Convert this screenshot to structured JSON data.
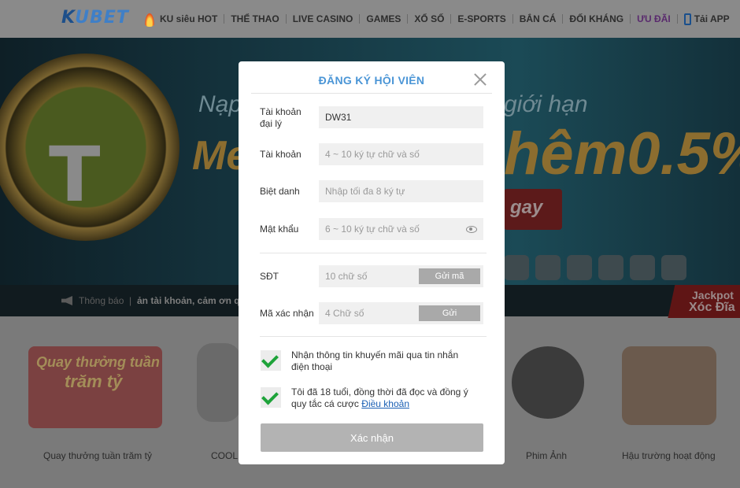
{
  "nav": {
    "logo": "KUBET",
    "items": [
      {
        "label": "KU siêu HOT",
        "icon": "fire-icon"
      },
      {
        "label": "THỂ THAO"
      },
      {
        "label": "LIVE CASINO"
      },
      {
        "label": "GAMES"
      },
      {
        "label": "XỔ SỐ"
      },
      {
        "label": "E-SPORTS"
      },
      {
        "label": "BẮN CÁ"
      },
      {
        "label": "ĐỐI KHÁNG"
      },
      {
        "label": "ƯU ĐÃI"
      },
      {
        "label": "Tải APP",
        "icon": "phone-icon"
      }
    ]
  },
  "banner": {
    "line1_left": "Nạp",
    "line1_right": "giới hạn",
    "big_left": "Me",
    "big_right": "hêm0.5%",
    "cta": "gay",
    "notice_label": "Thông báo",
    "notice_sep": "|",
    "notice_text": "ản tài khoản, cảm ơn qu",
    "jackpot_line1": "Jackpot",
    "jackpot_line2": "Xóc Đĩa"
  },
  "tiles": {
    "card_line1": "Quay thưởng tuần",
    "card_line2": "trăm tỷ",
    "labels": [
      "Quay thưởng tuần trăm tỷ",
      "COOL",
      "Phim Ảnh",
      "Hậu trường hoạt động"
    ]
  },
  "modal": {
    "title": "ĐĂNG KÝ HỘI VIÊN",
    "fields": {
      "agent_label": "Tài khoản đại lý",
      "agent_value": "DW31",
      "account_label": "Tài khoản",
      "account_placeholder": "4 ~ 10 ký tự chữ và số",
      "nickname_label": "Biệt danh",
      "nickname_placeholder": "Nhập tối đa 8 ký tự",
      "password_label": "Mật khẩu",
      "password_placeholder": "6 ~ 10 ký tự chữ và số",
      "phone_label": "SĐT",
      "phone_placeholder": "10 chữ số",
      "phone_button": "Gửi mã",
      "code_label": "Mã xác nhận",
      "code_placeholder": "4 Chữ số",
      "code_button": "Gửi"
    },
    "checks": {
      "promo_text": "Nhận thông tin khuyến mãi qua tin nhắn điện thoại",
      "terms_text": "Tôi đã 18 tuổi, đồng thời đã đọc và đồng ý quy tắc cá cược",
      "terms_link": "Điều khoản"
    },
    "submit": "Xác nhận"
  }
}
